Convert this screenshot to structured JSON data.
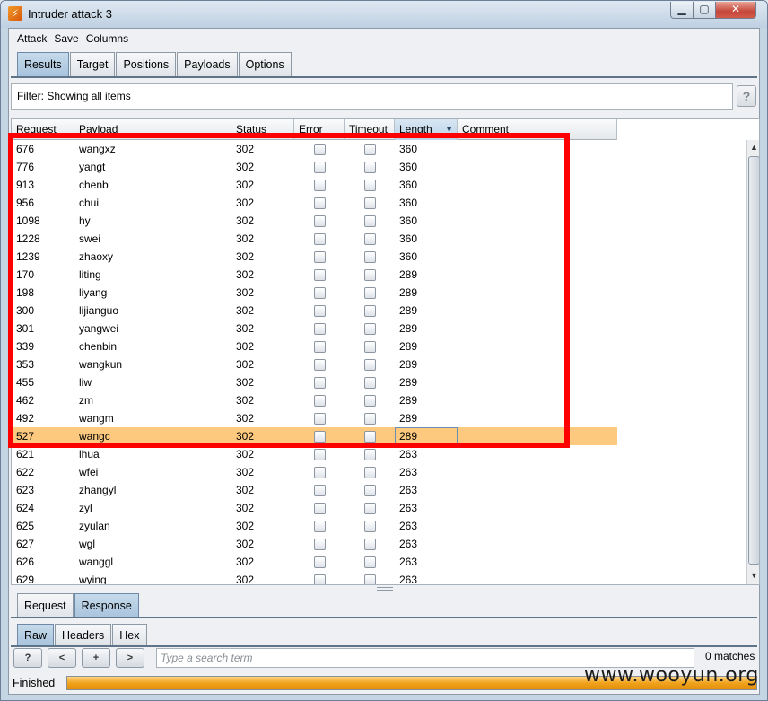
{
  "window": {
    "title": "Intruder attack 3",
    "icon_letter": "⚡"
  },
  "menu": [
    "Attack",
    "Save",
    "Columns"
  ],
  "main_tabs": [
    {
      "label": "Results",
      "active": true
    },
    {
      "label": "Target",
      "active": false
    },
    {
      "label": "Positions",
      "active": false
    },
    {
      "label": "Payloads",
      "active": false
    },
    {
      "label": "Options",
      "active": false
    }
  ],
  "filter": {
    "text": "Filter: Showing all items",
    "help": "?"
  },
  "table": {
    "columns": [
      "Request",
      "Payload",
      "Status",
      "Error",
      "Timeout",
      "Length",
      "Comment"
    ],
    "sorted_column": "Length",
    "rows": [
      {
        "request": "676",
        "payload": "wangxz",
        "status": "302",
        "length": "360",
        "selected": false
      },
      {
        "request": "776",
        "payload": "yangt",
        "status": "302",
        "length": "360",
        "selected": false
      },
      {
        "request": "913",
        "payload": "chenb",
        "status": "302",
        "length": "360",
        "selected": false
      },
      {
        "request": "956",
        "payload": "chui",
        "status": "302",
        "length": "360",
        "selected": false
      },
      {
        "request": "1098",
        "payload": "hy",
        "status": "302",
        "length": "360",
        "selected": false
      },
      {
        "request": "1228",
        "payload": "swei",
        "status": "302",
        "length": "360",
        "selected": false
      },
      {
        "request": "1239",
        "payload": "zhaoxy",
        "status": "302",
        "length": "360",
        "selected": false
      },
      {
        "request": "170",
        "payload": "liting",
        "status": "302",
        "length": "289",
        "selected": false
      },
      {
        "request": "198",
        "payload": "liyang",
        "status": "302",
        "length": "289",
        "selected": false
      },
      {
        "request": "300",
        "payload": "lijianguo",
        "status": "302",
        "length": "289",
        "selected": false
      },
      {
        "request": "301",
        "payload": "yangwei",
        "status": "302",
        "length": "289",
        "selected": false
      },
      {
        "request": "339",
        "payload": "chenbin",
        "status": "302",
        "length": "289",
        "selected": false
      },
      {
        "request": "353",
        "payload": "wangkun",
        "status": "302",
        "length": "289",
        "selected": false
      },
      {
        "request": "455",
        "payload": "liw",
        "status": "302",
        "length": "289",
        "selected": false
      },
      {
        "request": "462",
        "payload": "zm",
        "status": "302",
        "length": "289",
        "selected": false
      },
      {
        "request": "492",
        "payload": "wangm",
        "status": "302",
        "length": "289",
        "selected": false
      },
      {
        "request": "527",
        "payload": "wangc",
        "status": "302",
        "length": "289",
        "selected": true
      },
      {
        "request": "621",
        "payload": "lhua",
        "status": "302",
        "length": "263",
        "selected": false
      },
      {
        "request": "622",
        "payload": "wfei",
        "status": "302",
        "length": "263",
        "selected": false
      },
      {
        "request": "623",
        "payload": "zhangyl",
        "status": "302",
        "length": "263",
        "selected": false
      },
      {
        "request": "624",
        "payload": "zyl",
        "status": "302",
        "length": "263",
        "selected": false
      },
      {
        "request": "625",
        "payload": "zyulan",
        "status": "302",
        "length": "263",
        "selected": false
      },
      {
        "request": "627",
        "payload": "wgl",
        "status": "302",
        "length": "263",
        "selected": false
      },
      {
        "request": "626",
        "payload": "wanggl",
        "status": "302",
        "length": "263",
        "selected": false
      },
      {
        "request": "629",
        "payload": "wying",
        "status": "302",
        "length": "263",
        "selected": false
      }
    ]
  },
  "sub_tabs": [
    {
      "label": "Request",
      "active": false
    },
    {
      "label": "Response",
      "active": true
    }
  ],
  "view_tabs": [
    {
      "label": "Raw",
      "active": true
    },
    {
      "label": "Headers",
      "active": false
    },
    {
      "label": "Hex",
      "active": false
    }
  ],
  "search": {
    "buttons": [
      "?",
      "<",
      "+",
      ">"
    ],
    "placeholder": "Type a search term",
    "matches": "0 matches"
  },
  "status": {
    "text": "Finished",
    "progress": 1.0
  },
  "watermark": "www.wooyun.org",
  "colors": {
    "selected_row": "#fcc97f",
    "highlight_box": "#ff0000",
    "progress": "#f0a21c"
  }
}
